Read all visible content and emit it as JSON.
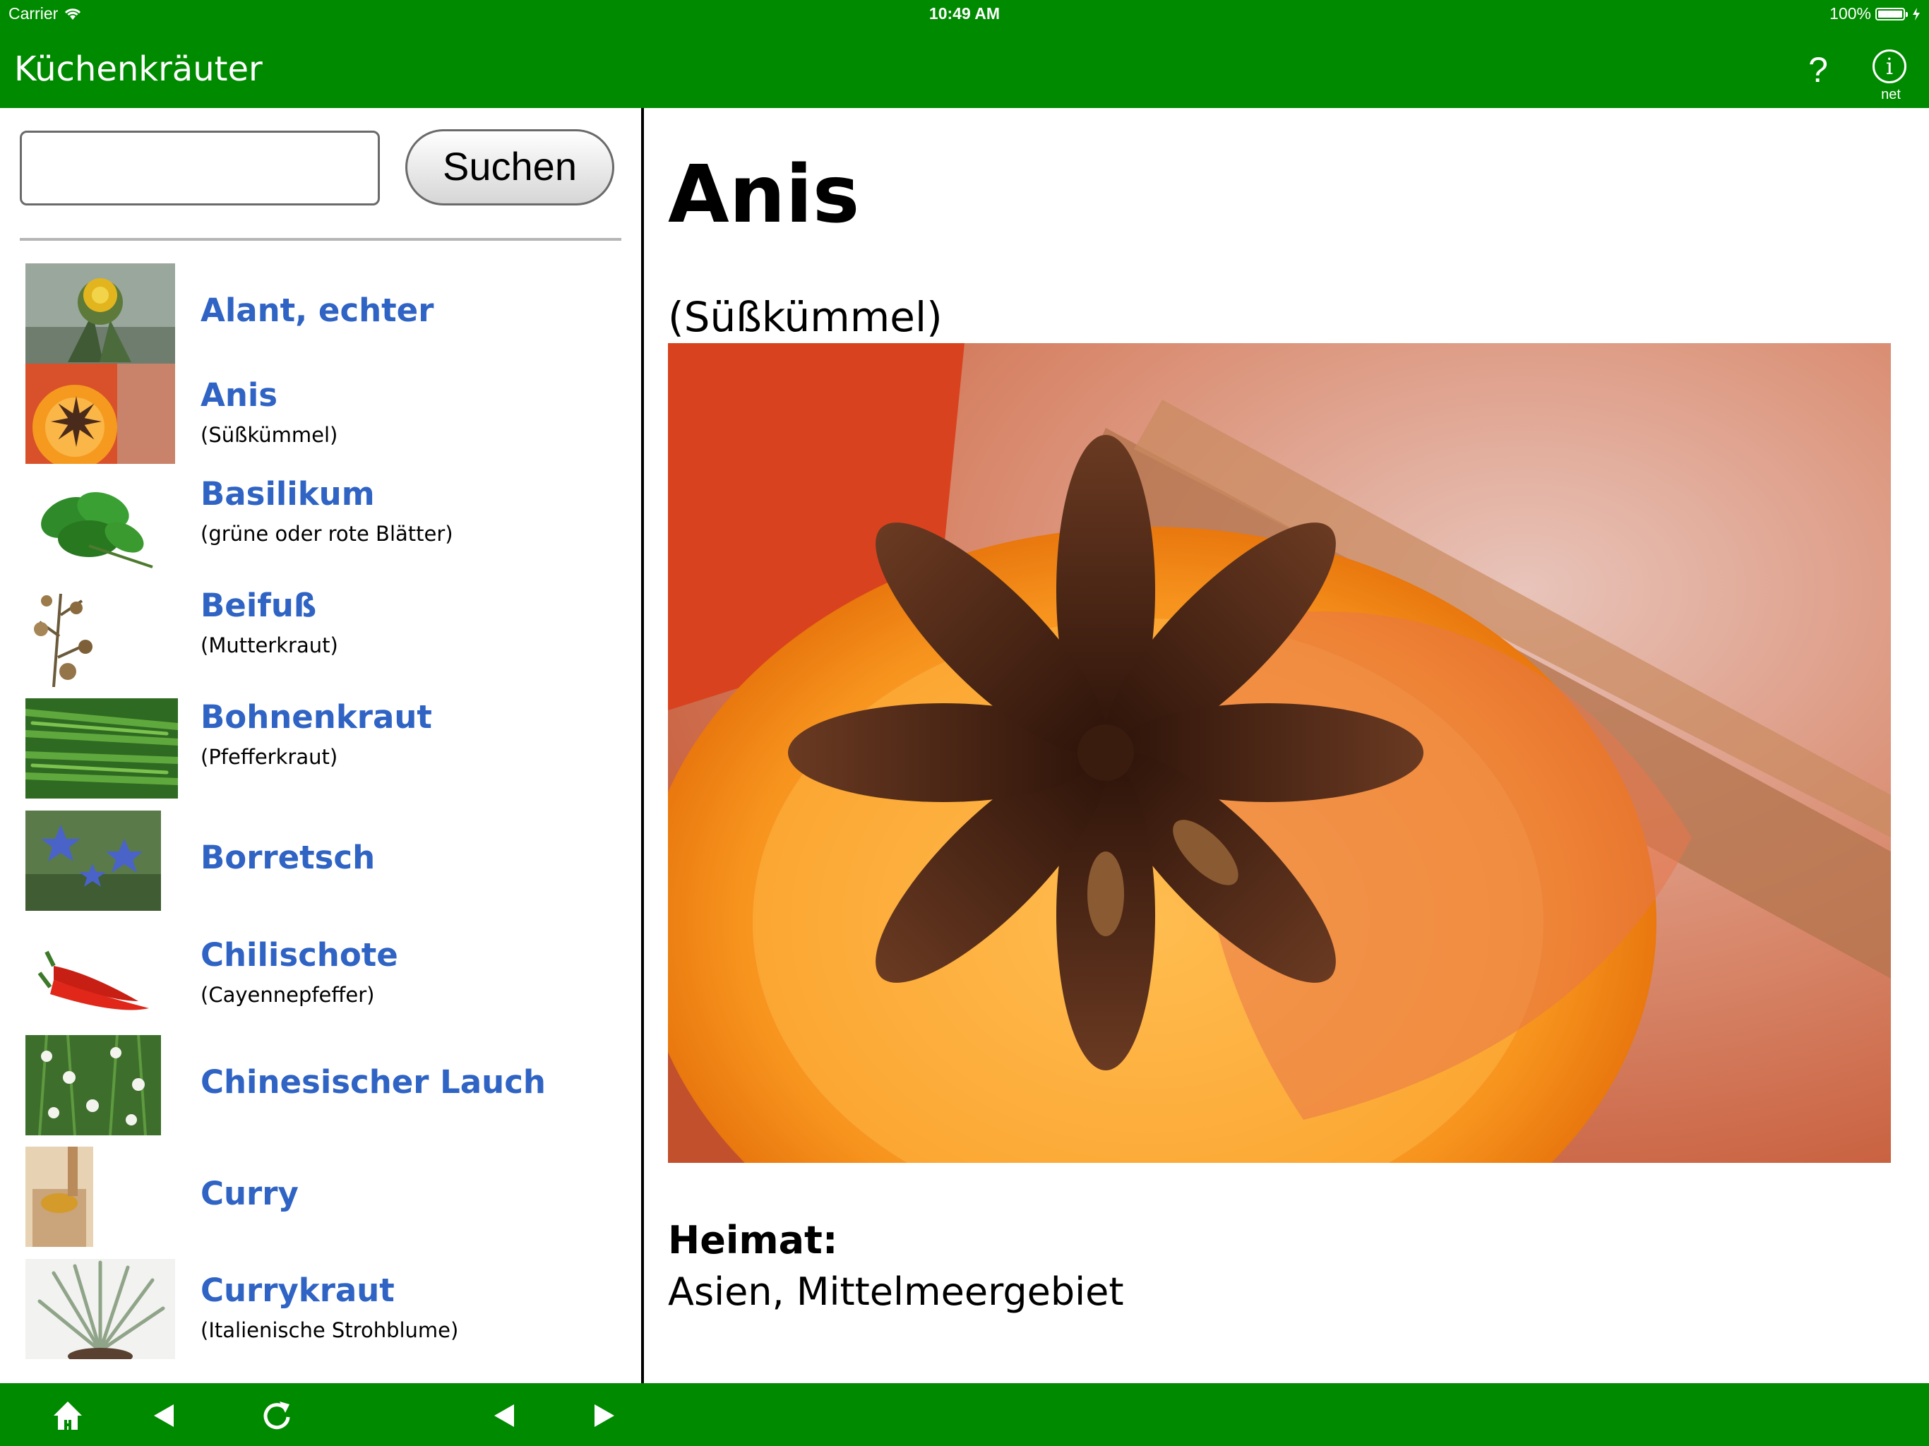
{
  "status": {
    "carrier": "Carrier",
    "time": "10:49 AM",
    "battery": "100%"
  },
  "nav": {
    "title": "Küchenkräuter",
    "help_label": "?",
    "info_label": "i",
    "info_sub": "net"
  },
  "search": {
    "value": "",
    "placeholder": "",
    "button_label": "Suchen"
  },
  "list": [
    {
      "name": "Alant, echter",
      "sub": "",
      "icon": "alant-thumbnail"
    },
    {
      "name": "Anis",
      "sub": "(Süßkümmel)",
      "icon": "anis-thumbnail"
    },
    {
      "name": "Basilikum",
      "sub": "(grüne oder rote Blätter)",
      "icon": "basilikum-thumbnail"
    },
    {
      "name": "Beifuß",
      "sub": "(Mutterkraut)",
      "icon": "beifuss-thumbnail"
    },
    {
      "name": "Bohnenkraut",
      "sub": "(Pfefferkraut)",
      "icon": "bohnenkraut-thumbnail"
    },
    {
      "name": "Borretsch",
      "sub": "",
      "icon": "borretsch-thumbnail"
    },
    {
      "name": "Chilischote",
      "sub": "(Cayennepfeffer)",
      "icon": "chilischote-thumbnail"
    },
    {
      "name": "Chinesischer Lauch",
      "sub": "",
      "icon": "lauch-thumbnail"
    },
    {
      "name": "Curry",
      "sub": "",
      "icon": "curry-thumbnail"
    },
    {
      "name": "Currykraut",
      "sub": "(Italienische Strohblume)",
      "icon": "currykraut-thumbnail"
    }
  ],
  "detail": {
    "title": "Anis",
    "subtitle": "(Süßkümmel)",
    "heimat_label": "Heimat:",
    "heimat_value": "Asien, Mittelmeergebiet"
  },
  "toolbar": {
    "icons": [
      "home-icon",
      "back-icon",
      "reload-icon",
      "previous-icon",
      "next-icon"
    ]
  },
  "colors": {
    "bar": "#008a00",
    "link": "#2f63c4"
  }
}
